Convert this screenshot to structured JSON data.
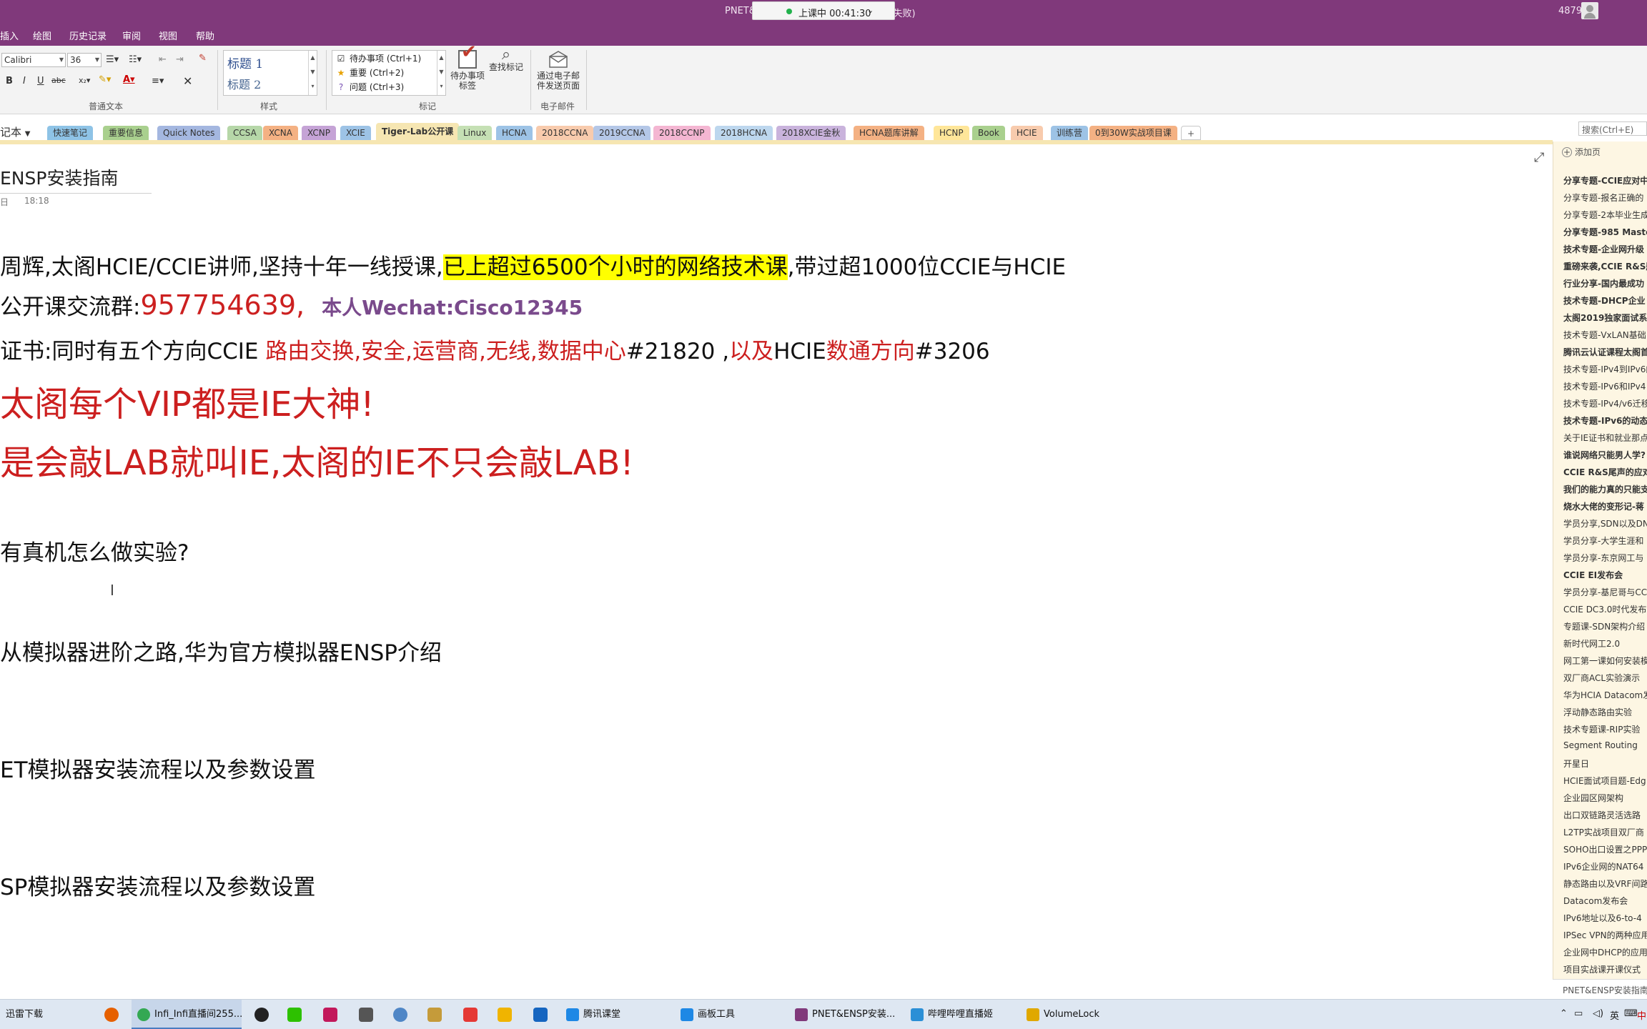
{
  "titlebar": {
    "title_fragment": "PNET&",
    "title_tail": "ዄ失败)",
    "live_status": "上课中 00:41:30",
    "viewer_count": "4879"
  },
  "menu": [
    "插入",
    "绘图",
    "历史记录",
    "审阅",
    "视图",
    "帮助"
  ],
  "ribbon": {
    "font_name": "Calibri",
    "font_size": "36",
    "style_h1": "标题 1",
    "style_h2": "标题 2",
    "tags": [
      {
        "icon": "checkbox-icon",
        "label": "待办事项 (Ctrl+1)"
      },
      {
        "icon": "star-icon",
        "label": "重要 (Ctrl+2)"
      },
      {
        "icon": "question-icon",
        "label": "问题 (Ctrl+3)"
      }
    ],
    "todo_tag_btn": [
      "待办事项",
      "标签"
    ],
    "find_tags_btn": "查找标记",
    "email_btn": [
      "通过电子邮",
      "件发送页面"
    ],
    "groups": {
      "basic_text": "普通文本",
      "styles": "样式",
      "tags": "标记",
      "email": "电子邮件"
    }
  },
  "notebook_name": "记本",
  "sections": [
    {
      "label": "快速笔记",
      "color": "#8ec3e6"
    },
    {
      "label": "重要信息",
      "color": "#a9d08e"
    },
    {
      "label": "Quick Notes",
      "color": "#a4b7e0"
    },
    {
      "label": "CCSA",
      "color": "#b6d7a8"
    },
    {
      "label": "XCNA",
      "color": "#f4b183"
    },
    {
      "label": "XCNP",
      "color": "#c5a3d6"
    },
    {
      "label": "XCIE",
      "color": "#9dc3e6"
    },
    {
      "label": "Tiger-Lab公开课",
      "color": "#f6e6b2"
    },
    {
      "label": "Linux",
      "color": "#c5e0b4"
    },
    {
      "label": "HCNA",
      "color": "#9dc3e6"
    },
    {
      "label": "2018CCNA",
      "color": "#f8cbad"
    },
    {
      "label": "2019CCNA",
      "color": "#b4c7e7"
    },
    {
      "label": "2018CCNP",
      "color": "#f4b6d2"
    },
    {
      "label": "2018HCNA",
      "color": "#bdd7ee"
    },
    {
      "label": "2018XCIE金秋",
      "color": "#c9b3dc"
    },
    {
      "label": "HCNA题库讲解",
      "color": "#f4b183"
    },
    {
      "label": "HCNP",
      "color": "#ffe699"
    },
    {
      "label": "Book",
      "color": "#a9d08e"
    },
    {
      "label": "HCIE",
      "color": "#f8cbad"
    },
    {
      "label": "训练营",
      "color": "#9dc3e6"
    },
    {
      "label": "0到30W实战项目课",
      "color": "#f4b183"
    }
  ],
  "add_section": "+",
  "search_placeholder": "搜索(Ctrl+E)",
  "page": {
    "title": "ENSP安装指南",
    "date": "日",
    "time": "18:18",
    "line1_a": "周辉,太阁HCIE/CCIE讲师,坚持十年一线授课,",
    "line1_hl": "已上超过6500个小时的网络技术课",
    "line1_b": ",带过超1000位CCIE与HCIE",
    "line2_a": "公开课交流群:",
    "line2_qq": "957754639,",
    "line2_wechat": "本人Wechat:Cisco12345",
    "line3_a": "证书:同时有五个方向CCIE ",
    "line3_red1": "路由交换,安全,运营商,无线,数据中心",
    "line3_b": "#21820 ,",
    "line3_red2": "以及",
    "line3_c": "HCIE",
    "line3_red3": "数通方向",
    "line3_d": "#3206",
    "line4": "太阁每个VIP都是IE大神!",
    "line5": "是会敲LAB就叫IE,太阁的IE不只会敲LAB!",
    "line6": "有真机怎么做实验?",
    "line7": "从模拟器进阶之路,华为官方模拟器ENSP介绍",
    "line8": "ET模拟器安装流程以及参数设置",
    "line9": "SP模拟器安装流程以及参数设置"
  },
  "page_list": {
    "add_page": "添加页",
    "items": [
      {
        "label": "分享专题-CCIE应对中",
        "bold": true
      },
      {
        "label": "分享专题-报名正确的",
        "bold": false
      },
      {
        "label": "分享专题-2本毕业生成",
        "bold": false
      },
      {
        "label": "分享专题-985 Master",
        "bold": true
      },
      {
        "label": "技术专题-企业网升级",
        "bold": true
      },
      {
        "label": "重磅来袭,CCIE R&S题",
        "bold": true
      },
      {
        "label": "行业分享-国内最成功",
        "bold": true
      },
      {
        "label": "技术专题-DHCP企业",
        "bold": true
      },
      {
        "label": "太阁2019独家面试系列",
        "bold": true
      },
      {
        "label": "技术专题-VxLAN基础",
        "bold": false
      },
      {
        "label": "腾讯云认证课程太阁首",
        "bold": true
      },
      {
        "label": "技术专题-IPv4到IPv6的",
        "bold": false
      },
      {
        "label": "技术专题-IPv6和IPv4",
        "bold": false
      },
      {
        "label": "技术专题-IPv4/v6迁移",
        "bold": false
      },
      {
        "label": "技术专题-IPv6的动态",
        "bold": true
      },
      {
        "label": "关于IE证书和就业那点",
        "bold": false
      },
      {
        "label": "谁说网络只能男人学?",
        "bold": true
      },
      {
        "label": "CCIE R&S尾声的应对",
        "bold": true
      },
      {
        "label": "我们的能力真的只能支",
        "bold": true
      },
      {
        "label": "烧水大佬的变形记-蒋",
        "bold": true
      },
      {
        "label": "学员分享,SDN以及DN",
        "bold": false
      },
      {
        "label": "学员分享-大学生涯和",
        "bold": false
      },
      {
        "label": "学员分享-东京网工与",
        "bold": false
      },
      {
        "label": "CCIE EI发布会",
        "bold": true
      },
      {
        "label": "学员分享-基尼哥与CC",
        "bold": false
      },
      {
        "label": "CCIE DC3.0时代发布",
        "bold": false
      },
      {
        "label": "专题课-SDN架构介绍",
        "bold": false
      },
      {
        "label": "新时代网工2.0",
        "bold": false
      },
      {
        "label": "网工第一课如何安装模",
        "bold": false
      },
      {
        "label": "双厂商ACL实验演示",
        "bold": false
      },
      {
        "label": "华为HCIA Datacom发",
        "bold": false
      },
      {
        "label": "浮动静态路由实验",
        "bold": false
      },
      {
        "label": "技术专题课-RIP实验",
        "bold": false
      },
      {
        "label": "Segment Routing",
        "bold": false
      },
      {
        "label": "开星日",
        "bold": false
      },
      {
        "label": "HCIE面试项目题-Edg",
        "bold": false
      },
      {
        "label": "企业园区网架构",
        "bold": false
      },
      {
        "label": "出口双链路灵活选路",
        "bold": false
      },
      {
        "label": "L2TP实战项目双厂商",
        "bold": false
      },
      {
        "label": "SOHO出口设置之PPP",
        "bold": false
      },
      {
        "label": "IPv6企业网的NAT64",
        "bold": false
      },
      {
        "label": "静态路由以及VRF间路",
        "bold": false
      },
      {
        "label": "Datacom发布会",
        "bold": false
      },
      {
        "label": "IPv6地址以及6-to-4",
        "bold": false
      },
      {
        "label": "IPSec VPN的两种应用",
        "bold": false
      },
      {
        "label": "企业网中DHCP的应用",
        "bold": false
      },
      {
        "label": "项目实战课开课仪式",
        "bold": false
      }
    ],
    "bottom": "PNET&ENSP安装指南"
  },
  "taskbar": {
    "items": [
      {
        "label": "迅雷下载",
        "active": false,
        "color": "#3a7bd5"
      },
      {
        "label": "Infi_Infi直播间255...",
        "active": true,
        "color": "#34a853"
      },
      {
        "label": "腾讯课堂",
        "active": false,
        "color": "#1e88e5"
      },
      {
        "label": "画板工具",
        "active": false,
        "color": "#1e88e5"
      },
      {
        "label": "PNET&ENSP安装...",
        "active": false,
        "color": "#80397b"
      },
      {
        "label": "哔哩哔哩直播姬",
        "active": false,
        "color": "#2b8fd6"
      },
      {
        "label": "VolumeLock",
        "active": false,
        "color": "#e0a800"
      }
    ],
    "tray_lang": "英",
    "tray_input": "中"
  }
}
